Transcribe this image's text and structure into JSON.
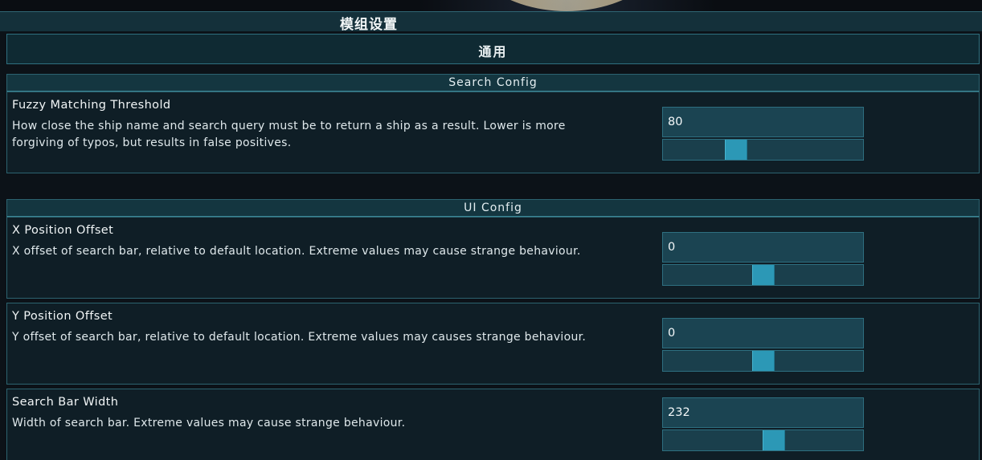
{
  "window": {
    "title": "模组设置"
  },
  "tab": {
    "label": "通用"
  },
  "sections": [
    {
      "header": "Search Config",
      "settings": [
        {
          "title": "Fuzzy Matching Threshold",
          "description": "How close the ship name and search query must be to return a ship as a result. Lower is more forgiving of typos, but results in false positives.",
          "value": "80",
          "slider_fraction": 0.35
        }
      ]
    },
    {
      "header": "UI Config",
      "settings": [
        {
          "title": "X Position Offset",
          "description": "X offset of search bar, relative to default location. Extreme values may cause strange behaviour.",
          "value": "0",
          "slider_fraction": 0.5
        },
        {
          "title": "Y Position Offset",
          "description": "Y offset of search bar, relative to default location. Extreme values may causes strange behaviour.",
          "value": "0",
          "slider_fraction": 0.5
        },
        {
          "title": "Search Bar Width",
          "description": "Width of search bar. Extreme values may cause strange behaviour.",
          "value": "232",
          "slider_fraction": 0.56
        }
      ]
    }
  ],
  "colors": {
    "accent": "#2c98b6",
    "panel": "#0f1e26",
    "border": "#2c6370"
  }
}
